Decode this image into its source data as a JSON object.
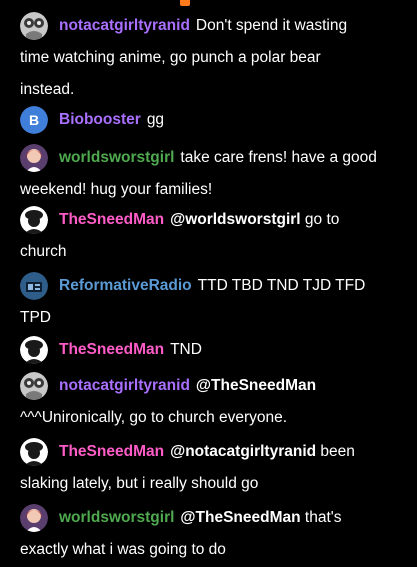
{
  "colors": {
    "background": "#000000",
    "accent_orange": "#ff7a1a",
    "purple_user": "#a970ff",
    "green_user": "#4fa94f",
    "pink_user": "#ff5cc8",
    "blue_user": "#5b9bd5",
    "text": "#ffffff"
  },
  "messages": [
    {
      "username": "notacatgirltyranid",
      "avatar_icon": "raccoon-avatar-icon",
      "line1": "Don't spend it wasting",
      "cont": [
        "time watching anime, go punch a polar bear",
        "instead."
      ]
    },
    {
      "username": "Biobooster",
      "avatar_icon": "letter-b-avatar-icon",
      "avatar_letter": "B",
      "line1": "gg",
      "cont": []
    },
    {
      "username": "worldsworstgirl",
      "avatar_icon": "girl-avatar-icon",
      "line1": "take care frens! have a good",
      "cont": [
        "weekend! hug your families!"
      ]
    },
    {
      "username": "TheSneedMan",
      "avatar_icon": "man-avatar-icon",
      "mention": "@worldsworstgirl",
      "line1": "go to",
      "cont": [
        "church"
      ]
    },
    {
      "username": "ReformativeRadio",
      "avatar_icon": "radio-avatar-icon",
      "line1": "TTD TBD TND TJD TFD",
      "cont": [
        "TPD"
      ]
    },
    {
      "username": "TheSneedMan",
      "avatar_icon": "man-avatar-icon",
      "line1": "TND",
      "cont": []
    },
    {
      "username": "notacatgirltyranid",
      "avatar_icon": "raccoon-avatar-icon",
      "mention": "@TheSneedMan",
      "line1": "",
      "cont": [
        "^^^Unironically, go to church everyone."
      ]
    },
    {
      "username": "TheSneedMan",
      "avatar_icon": "man-avatar-icon",
      "mention": "@notacatgirltyranid",
      "line1": "been",
      "cont": [
        "slaking lately, but i really should go"
      ]
    },
    {
      "username": "worldsworstgirl",
      "avatar_icon": "girl-avatar-icon",
      "mention": "@TheSneedMan",
      "line1": "that's",
      "cont": [
        "exactly what i was going to do"
      ]
    }
  ]
}
